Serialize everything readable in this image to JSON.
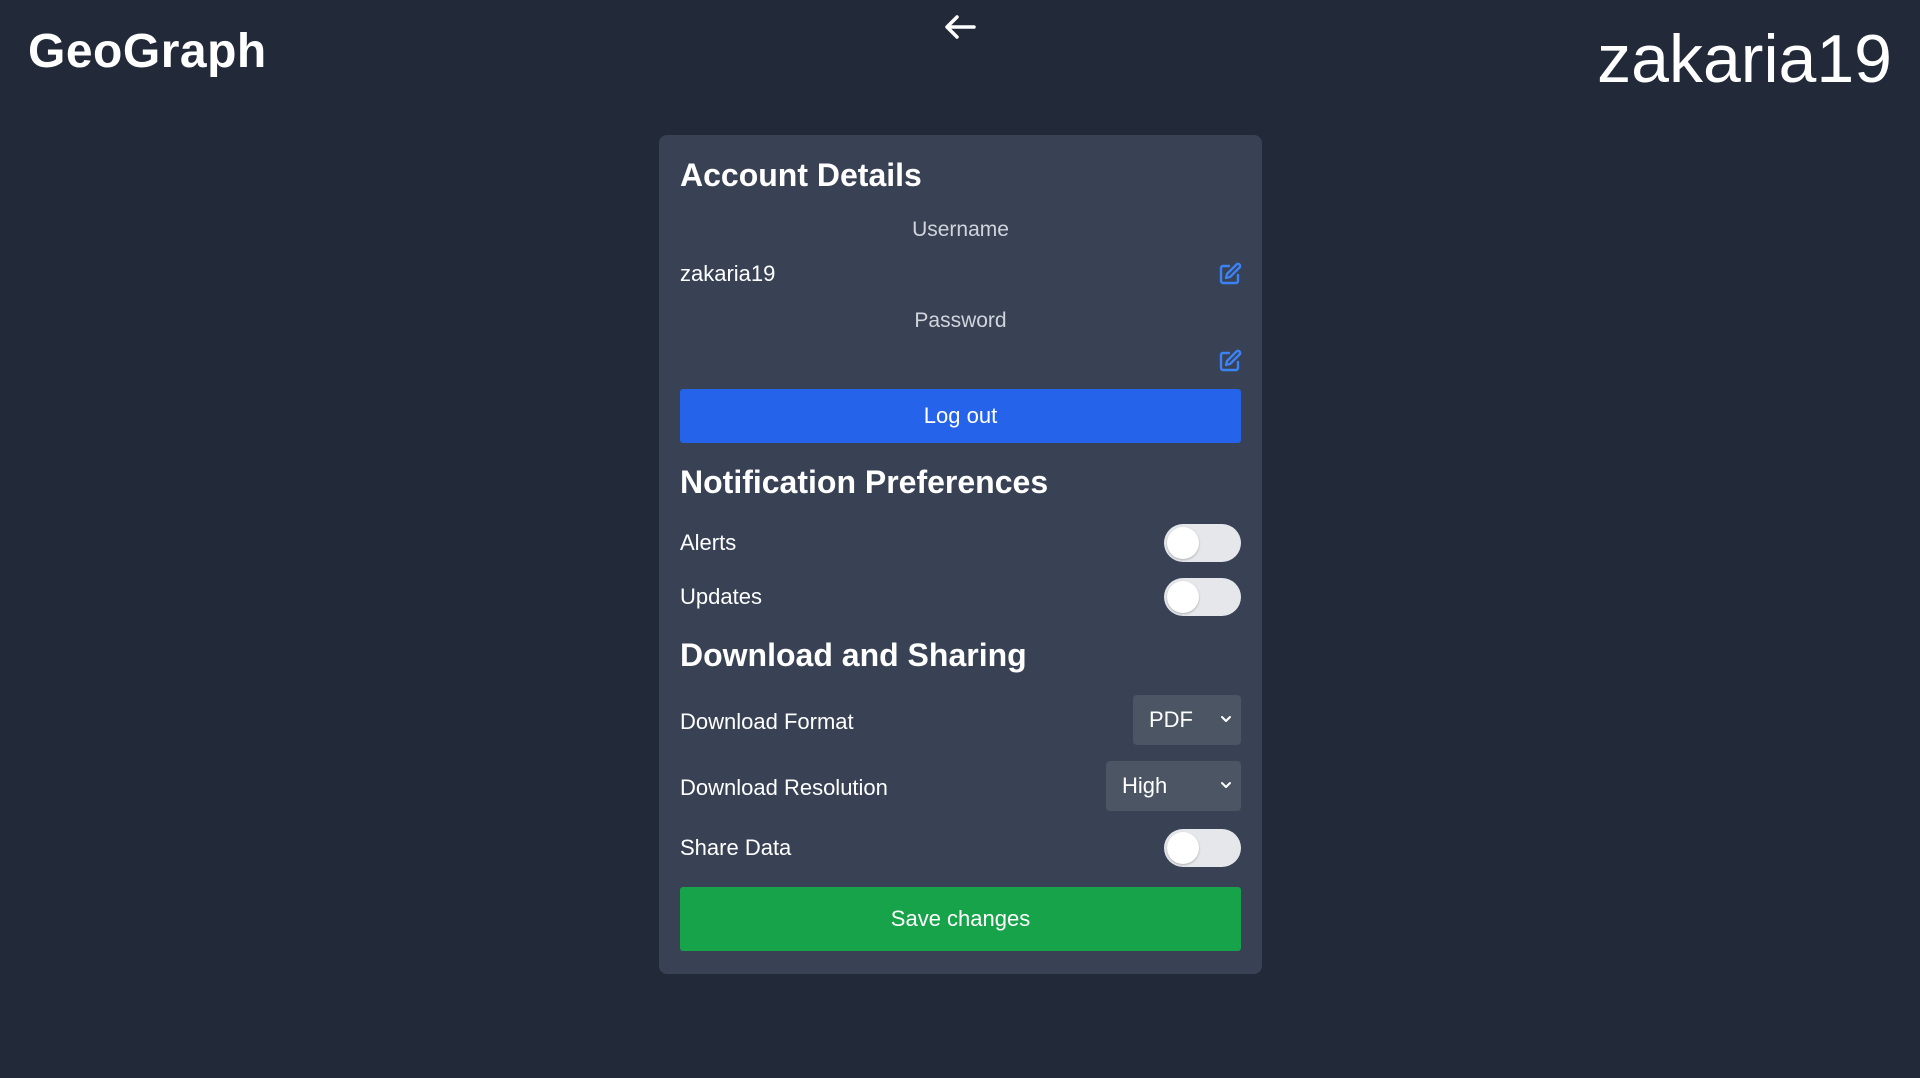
{
  "header": {
    "app_title": "GeoGraph",
    "username_display": "zakaria19"
  },
  "account": {
    "title": "Account Details",
    "username_label": "Username",
    "username_value": "zakaria19",
    "password_label": "Password",
    "logout_label": "Log out"
  },
  "notifications": {
    "title": "Notification Preferences",
    "alerts_label": "Alerts",
    "alerts_on": false,
    "updates_label": "Updates",
    "updates_on": false
  },
  "download": {
    "title": "Download and Sharing",
    "format_label": "Download Format",
    "format_value": "PDF",
    "resolution_label": "Download Resolution",
    "resolution_value": "High",
    "share_label": "Share Data",
    "share_on": false
  },
  "save_label": "Save changes",
  "colors": {
    "background": "#222a3a",
    "card": "#384254",
    "primary": "#2563eb",
    "success": "#16a34a",
    "edit_icon": "#3b82f6"
  },
  "icons": {
    "back": "arrow-left-icon",
    "edit": "edit-icon",
    "dropdown": "chevron-down-icon"
  }
}
